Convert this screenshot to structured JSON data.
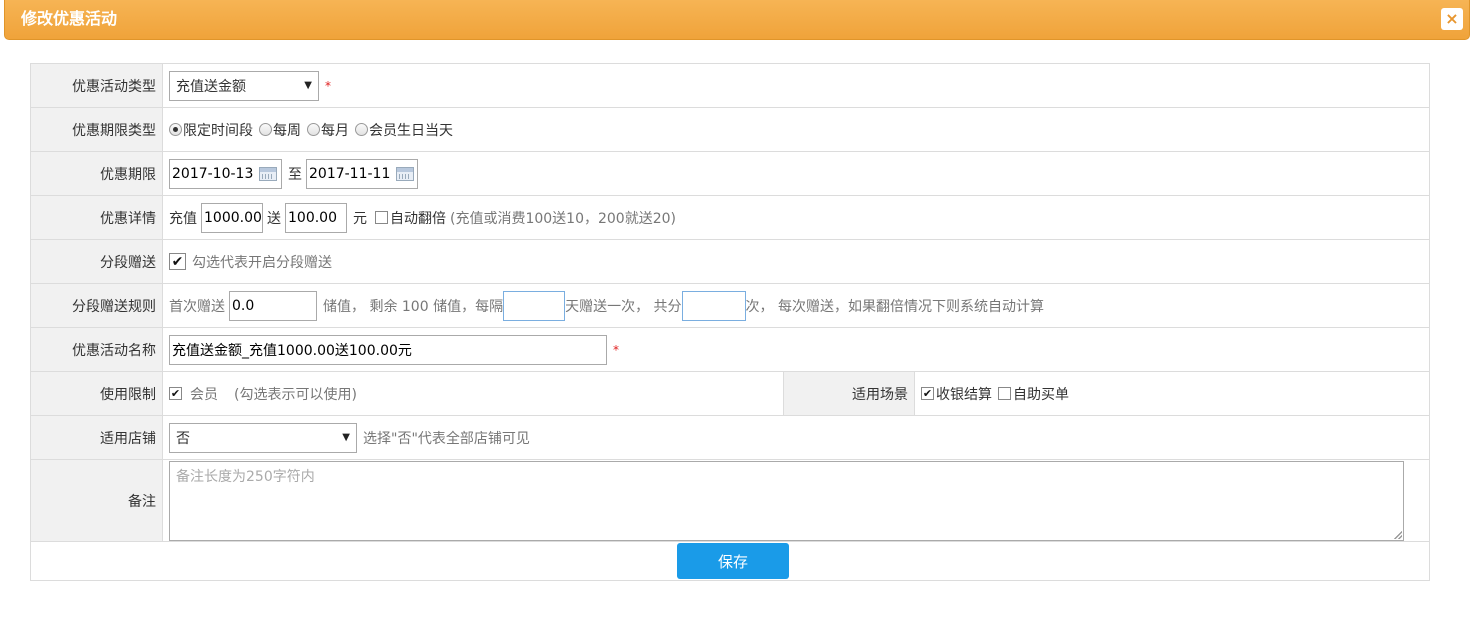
{
  "dialog": {
    "title": "修改优惠活动",
    "close_label": "×"
  },
  "promo_type": {
    "label": "优惠活动类型",
    "value": "充值送金额",
    "required": "*"
  },
  "period_type": {
    "label": "优惠期限类型",
    "options": [
      "限定时间段",
      "每周",
      "每月",
      "会员生日当天"
    ],
    "selected_index": 0
  },
  "period": {
    "label": "优惠期限",
    "start": "2017-10-13",
    "sep": "至",
    "end": "2017-11-11"
  },
  "detail": {
    "label": "优惠详情",
    "recharge_label": "充值",
    "recharge_value": "1000.00",
    "gift_label": "送",
    "gift_value": "100.00",
    "unit": "元",
    "auto_double_label": "自动翻倍",
    "auto_double_checked": false,
    "hint": "(充值或消费100送10，200就送20)"
  },
  "segment": {
    "label": "分段赠送",
    "checked": true,
    "hint": "勾选代表开启分段赠送"
  },
  "segment_rule": {
    "label": "分段赠送规则",
    "first_label": "首次赠送",
    "first_value": "0.0",
    "text1": "储值， 剩余 100 储值，每隔",
    "interval_value": "",
    "text2": "天赠送一次， 共分",
    "count_value": "",
    "text3": "次， 每次赠送，如果翻倍情况下则系统自动计算"
  },
  "name": {
    "label": "优惠活动名称",
    "value": "充值送金额_充值1000.00送100.00元",
    "required": "*"
  },
  "usage": {
    "label": "使用限制",
    "member_label": "会员",
    "member_checked": true,
    "hint": "(勾选表示可以使用)",
    "scene_label": "适用场景",
    "scene_options": [
      {
        "label": "收银结算",
        "checked": true
      },
      {
        "label": "自助买单",
        "checked": false
      }
    ]
  },
  "store": {
    "label": "适用店铺",
    "value": "否",
    "hint": "选择\"否\"代表全部店铺可见"
  },
  "remark": {
    "label": "备注",
    "placeholder": "备注长度为250字符内"
  },
  "save_label": "保存"
}
